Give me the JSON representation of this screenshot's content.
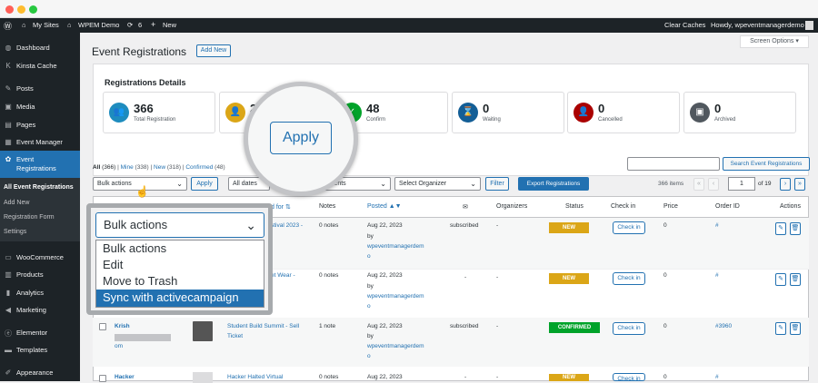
{
  "adminbar": {
    "my_sites": "My Sites",
    "site_name": "WPEM Demo",
    "updates_count": "6",
    "new_label": "New",
    "clear_caches": "Clear Caches",
    "howdy": "Howdy, wpeventmanagerdemo"
  },
  "sidebar": {
    "items": [
      {
        "label": "Dashboard",
        "icon": "dashboard-icon"
      },
      {
        "label": "Kinsta Cache",
        "icon": "kinsta-icon"
      },
      {
        "label": "Posts",
        "icon": "pin-icon"
      },
      {
        "label": "Media",
        "icon": "media-icon"
      },
      {
        "label": "Pages",
        "icon": "pages-icon"
      },
      {
        "label": "Event Manager",
        "icon": "calendar-icon"
      },
      {
        "label": "Event Registrations",
        "icon": "registrations-icon"
      },
      {
        "label": "WooCommerce",
        "icon": "woo-icon"
      },
      {
        "label": "Products",
        "icon": "products-icon"
      },
      {
        "label": "Analytics",
        "icon": "analytics-icon"
      },
      {
        "label": "Marketing",
        "icon": "megaphone-icon"
      },
      {
        "label": "Elementor",
        "icon": "elementor-icon"
      },
      {
        "label": "Templates",
        "icon": "templates-icon"
      },
      {
        "label": "Appearance",
        "icon": "brush-icon"
      }
    ],
    "submenu": [
      "All Event Registrations",
      "Add New",
      "Registration Form",
      "Settings"
    ]
  },
  "page": {
    "title": "Event Registrations",
    "add_new": "Add New",
    "screen_options": "Screen Options ▾"
  },
  "stats": {
    "heading": "Registrations Details",
    "cards": [
      {
        "value": "366",
        "label": "Total Registration",
        "color": "#1e8cbe"
      },
      {
        "value": "2",
        "label": "",
        "color": "#dba617"
      },
      {
        "value": "48",
        "label": "Confirm",
        "color": "#00a32a"
      },
      {
        "value": "0",
        "label": "Waiting",
        "color": "#135e96"
      },
      {
        "value": "0",
        "label": "Cancelled",
        "color": "#a00"
      },
      {
        "value": "0",
        "label": "Archived",
        "color": "#50575e"
      }
    ]
  },
  "filters": {
    "views": [
      {
        "label": "All",
        "count": "(366)"
      },
      {
        "label": "Mine",
        "count": "(338)"
      },
      {
        "label": "New",
        "count": "(318)"
      },
      {
        "label": "Confirmed",
        "count": "(48)"
      }
    ],
    "bulk_actions": "Bulk actions",
    "apply": "Apply",
    "all_dates": "All dates",
    "event_filter": "for all events",
    "organizer_filter": "Select Organizer",
    "filter_button": "Filter",
    "export_button": "Export Registrations",
    "search_button": "Search Event Registrations",
    "items_count": "366 items",
    "current_page": "1",
    "of_pages": "of 19"
  },
  "zoom": {
    "apply": "Apply"
  },
  "dropdown": {
    "selected": "Bulk actions",
    "options": [
      "Bulk actions",
      "Edit",
      "Move to Trash",
      "Sync with activecampaign"
    ]
  },
  "table": {
    "headers": {
      "registered_for": "d for",
      "notes": "Notes",
      "posted": "Posted",
      "organizers": "Organizers",
      "status": "Status",
      "check_in": "Check in",
      "price": "Price",
      "order_id": "Order ID",
      "actions": "Actions"
    },
    "rows": [
      {
        "name": "",
        "event": "stival 2023 -",
        "notes": "0 notes",
        "date": "Aug 22, 2023",
        "by": "by",
        "user": "wpeventmanagerdem",
        "user2": "o",
        "email": "subscribed",
        "organizers": "-",
        "status": "NEW",
        "status_color": "#dba617",
        "check_in": "Check in",
        "price": "0",
        "order": "#"
      },
      {
        "name": "",
        "event": "et Wear -",
        "notes": "0 notes",
        "date": "Aug 22, 2023",
        "by": "by",
        "user": "wpeventmanagerdem",
        "user2": "o",
        "email": "-",
        "organizers": "-",
        "status": "NEW",
        "status_color": "#dba617",
        "check_in": "Check in",
        "price": "0",
        "order": "#"
      },
      {
        "name": "Krish",
        "name2": "om",
        "event": "Student Build Summit - Sell",
        "event2": "Ticket",
        "notes": "1 note",
        "date": "Aug 22, 2023",
        "by": "by",
        "user": "wpeventmanagerdem",
        "user2": "o",
        "email": "subscribed",
        "organizers": "-",
        "status": "CONFIRMED",
        "status_color": "#00a32a",
        "check_in": "Check in",
        "price": "0",
        "order": "#3960"
      },
      {
        "name": "Hacker",
        "event": "Hacker Halted Virtual",
        "notes": "0 notes",
        "date": "Aug 22, 2023",
        "email": "-",
        "organizers": "-",
        "status": "NEW",
        "status_color": "#dba617",
        "check_in": "Check in",
        "price": "0",
        "order": "#"
      }
    ]
  }
}
